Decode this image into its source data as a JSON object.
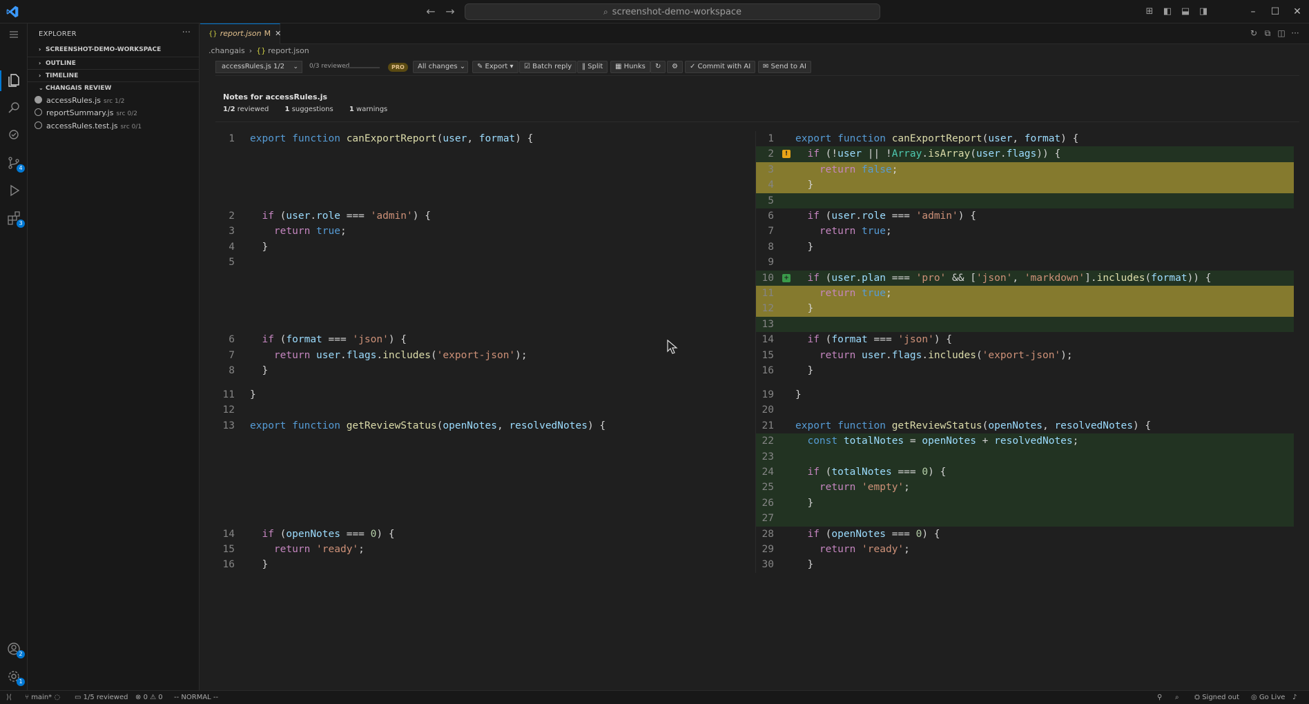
{
  "window": {
    "search_text": "screenshot-demo-workspace"
  },
  "activity": {
    "source_control_badge": "4",
    "extensions_badge": "3",
    "accounts_badge": "2",
    "settings_badge": "1"
  },
  "sidebar": {
    "header": "EXPLORER",
    "sections": {
      "workspace": "SCREENSHOT-DEMO-WORKSPACE",
      "outline": "OUTLINE",
      "timeline": "TIMELINE",
      "review": "CHANGAIS REVIEW"
    },
    "files": [
      {
        "name": "accessRules.js",
        "meta": "src 1/2"
      },
      {
        "name": "reportSummary.js",
        "meta": "src 0/2"
      },
      {
        "name": "accessRules.test.js",
        "meta": "src 0/1"
      }
    ]
  },
  "editor": {
    "tab": {
      "label": "report.json",
      "status": "M"
    },
    "breadcrumb": {
      "folder": ".changais",
      "file": "report.json"
    },
    "toolbar": {
      "file_select": "accessRules.js 1/2",
      "reviewed": "0/3 reviewed",
      "progress": 0,
      "pro_badge": "PRO",
      "changes_select": "All changes",
      "export": "✎ Export ▾",
      "batch_reply": "☑ Batch reply",
      "split": "‖ Split",
      "hunks": "▦ Hunks",
      "refresh": "↻",
      "settings": "⚙",
      "commit": "✓ Commit with AI",
      "send": "✉ Send to AI"
    },
    "notes": {
      "title": "Notes for accessRules.js",
      "reviewed": "1/2",
      "reviewed_label": "reviewed",
      "suggestions": "1",
      "suggestions_label": "suggestions",
      "warnings": "1",
      "warnings_label": "warnings"
    }
  },
  "statusbar": {
    "branch": "main*",
    "reviewed": "1/5 reviewed",
    "problems": "0",
    "warnings": "0",
    "mode": "-- NORMAL --",
    "signed_out": "Signed out",
    "go_live": "Go Live"
  }
}
